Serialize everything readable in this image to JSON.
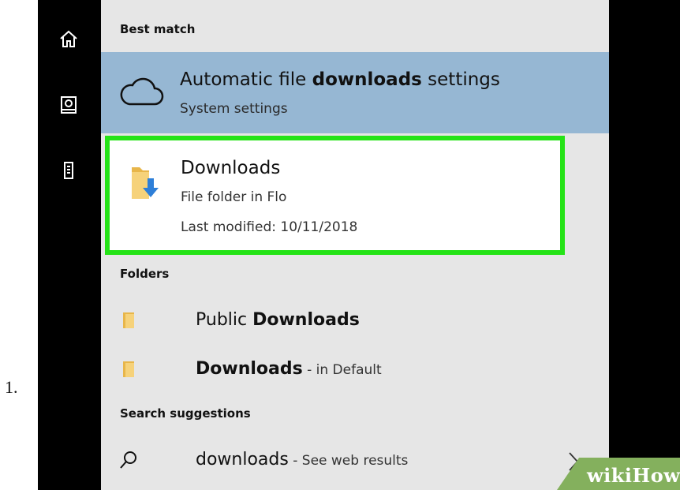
{
  "list_marker": "1.",
  "search": {
    "best_match": {
      "heading": "Best match",
      "item": {
        "title_prefix": "Automatic file ",
        "title_bold": "downloads",
        "title_suffix": " settings",
        "subtitle": "System settings",
        "icon": "cloud-icon",
        "background": "#96b7d3"
      }
    },
    "downloads_card": {
      "title": "Downloads",
      "subtitle": "File folder in Flo",
      "modified": "Last modified: 10/11/2018",
      "icon": "folder-download-icon",
      "highlight_color": "#25e317"
    },
    "folders": {
      "heading": "Folders",
      "items": [
        {
          "prefix": "Public ",
          "bold": "Downloads",
          "suffix": ""
        },
        {
          "prefix": "",
          "bold": "Downloads",
          "suffix": " - in Default"
        }
      ]
    },
    "suggestions": {
      "heading": "Search suggestions",
      "item": {
        "query": "downloads",
        "suffix": " - See web results",
        "icon": "search-icon"
      }
    }
  },
  "sidebar": {
    "icons": [
      "home-icon",
      "documents-icon",
      "device-icon"
    ]
  },
  "watermark": {
    "wiki": "wiki",
    "how": "How",
    "color": "#84b05d"
  }
}
